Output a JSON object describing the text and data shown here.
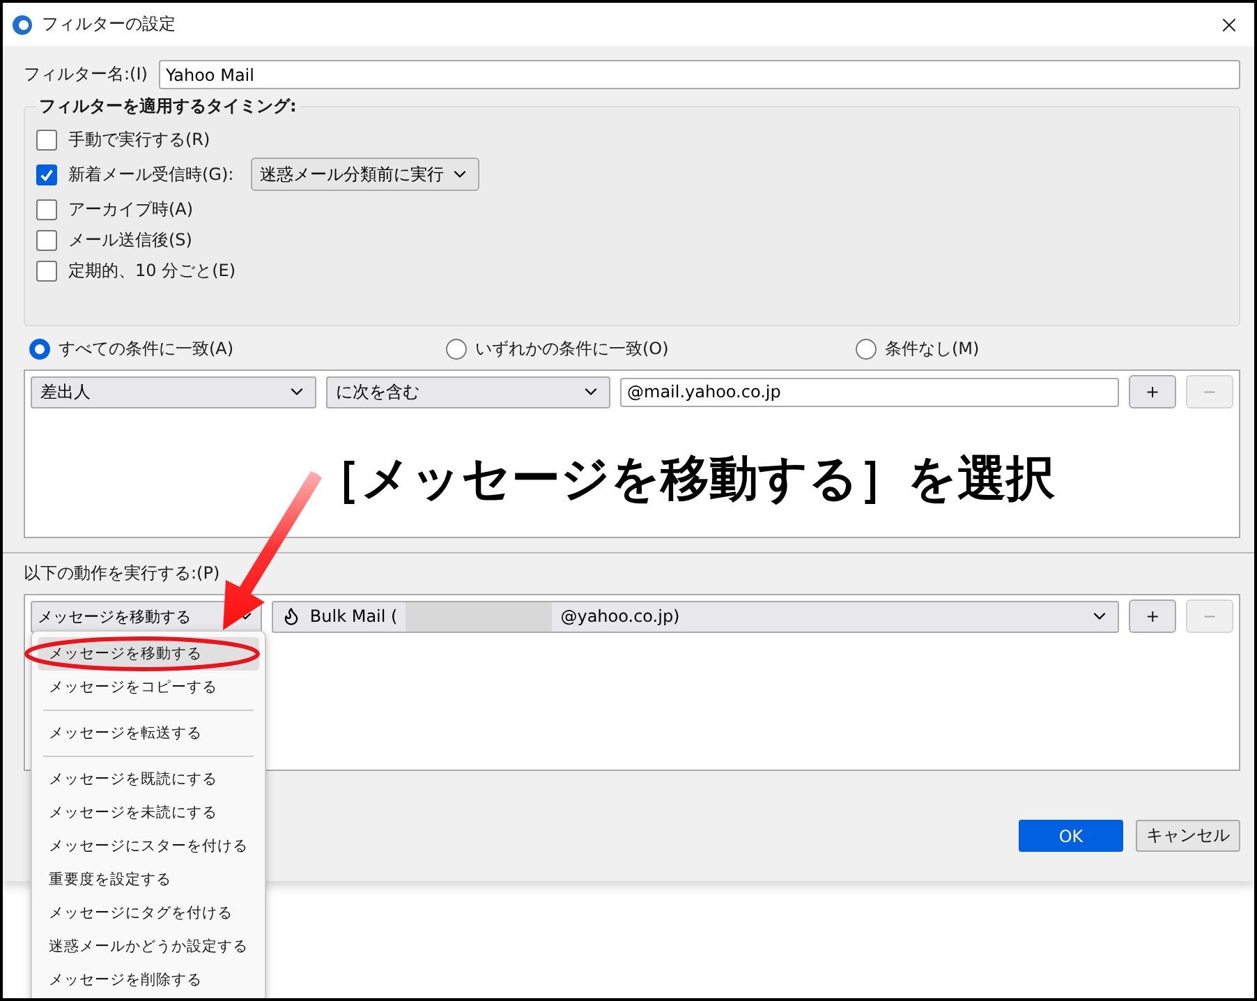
{
  "window": {
    "title": "フィルターの設定"
  },
  "filter_name": {
    "label": "フィルター名:(I)",
    "value": "Yahoo Mail"
  },
  "timing": {
    "title": "フィルターを適用するタイミング:",
    "options": [
      {
        "label": "手動で実行する(R)",
        "checked": false
      },
      {
        "label": "新着メール受信時(G):",
        "checked": true,
        "select": "迷惑メール分類前に実行"
      },
      {
        "label": "アーカイブ時(A)",
        "checked": false
      },
      {
        "label": "メール送信後(S)",
        "checked": false
      },
      {
        "label": "定期的、10 分ごと(E)",
        "checked": false
      }
    ]
  },
  "match": [
    {
      "label": "すべての条件に一致(A)",
      "selected": true
    },
    {
      "label": "いずれかの条件に一致(O)",
      "selected": false
    },
    {
      "label": "条件なし(M)",
      "selected": false
    }
  ],
  "conditions": [
    {
      "field": "差出人",
      "operator": "に次を含む",
      "value": "@mail.yahoo.co.jp",
      "add": "+",
      "remove": "−",
      "remove_disabled": true
    }
  ],
  "actions": {
    "label": "以下の動作を実行する:(P)",
    "rows": [
      {
        "action": "メッセージを移動する",
        "target_before": "Bulk Mail (",
        "target_redacted": true,
        "target_after": "@yahoo.co.jp)",
        "add": "+",
        "remove": "−",
        "remove_disabled": true
      }
    ]
  },
  "menu": [
    {
      "kind": "item",
      "label": "メッセージを移動する",
      "selected": true
    },
    {
      "kind": "item",
      "label": "メッセージをコピーする",
      "selected": false
    },
    {
      "kind": "separator"
    },
    {
      "kind": "item",
      "label": "メッセージを転送する",
      "selected": false
    },
    {
      "kind": "separator"
    },
    {
      "kind": "item",
      "label": "メッセージを既読にする",
      "selected": false
    },
    {
      "kind": "item",
      "label": "メッセージを未読にする",
      "selected": false
    },
    {
      "kind": "item",
      "label": "メッセージにスターを付ける",
      "selected": false
    },
    {
      "kind": "item",
      "label": "重要度を設定する",
      "selected": false
    },
    {
      "kind": "item",
      "label": "メッセージにタグを付ける",
      "selected": false
    },
    {
      "kind": "item",
      "label": "迷惑メールかどうか設定する",
      "selected": false
    },
    {
      "kind": "item",
      "label": "メッセージを削除する",
      "selected": false
    }
  ],
  "buttons": [
    {
      "label": "OK",
      "kind": "primary"
    },
    {
      "label": "キャンセル",
      "kind": "default"
    }
  ],
  "annotation": {
    "text": "［メッセージを移動する］を選択"
  }
}
